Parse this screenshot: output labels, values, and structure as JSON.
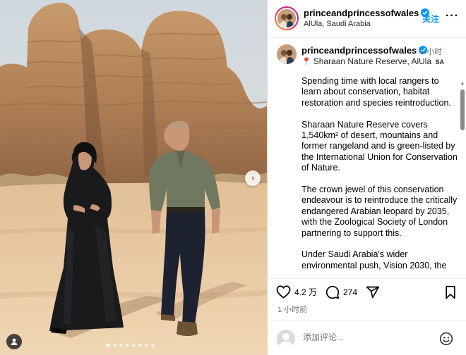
{
  "header": {
    "username": "princeandprincessofwales",
    "follow_label": "关注",
    "location": "AlUla, Saudi Arabia",
    "more_label": "···"
  },
  "caption": {
    "username": "princeandprincessofwales",
    "time": "1 小时",
    "location": "Sharaan Nature Reserve, AlUla",
    "location_flag": "SA",
    "paragraphs": [
      "Spending time with local rangers to learn about conservation, habitat restoration and species reintroduction.",
      "Sharaan Nature Reserve covers 1,540km² of desert, mountains and former rangeland and is green-listed by the International Union for Conservation of Nature.",
      "The crown jewel of this conservation endeavour is to reintroduce the critically endangered Arabian leopard by 2035, with the Zoological Society of London partnering to support this.",
      "Under Saudi Arabia's wider environmental push, Vision 2030, the"
    ]
  },
  "actions": {
    "likes": "4.2 万",
    "comments": "274",
    "posted_ago": "1 小时前"
  },
  "comment_box": {
    "placeholder": "添加评论..."
  },
  "carousel": {
    "slide_count": 8,
    "active_index": 0
  },
  "icons": {
    "like": "heart-icon",
    "comment": "comment-bubble-icon",
    "share": "paper-plane-icon",
    "save": "bookmark-icon",
    "emoji": "smiley-icon",
    "next": "chevron-right-icon",
    "user_tag": "user-silhouette-icon",
    "verified": "verified-badge-icon",
    "location": "location-pin-icon"
  },
  "colors": {
    "accent": "#0095f6",
    "verified": "#0095f6",
    "muted": "#737373"
  }
}
